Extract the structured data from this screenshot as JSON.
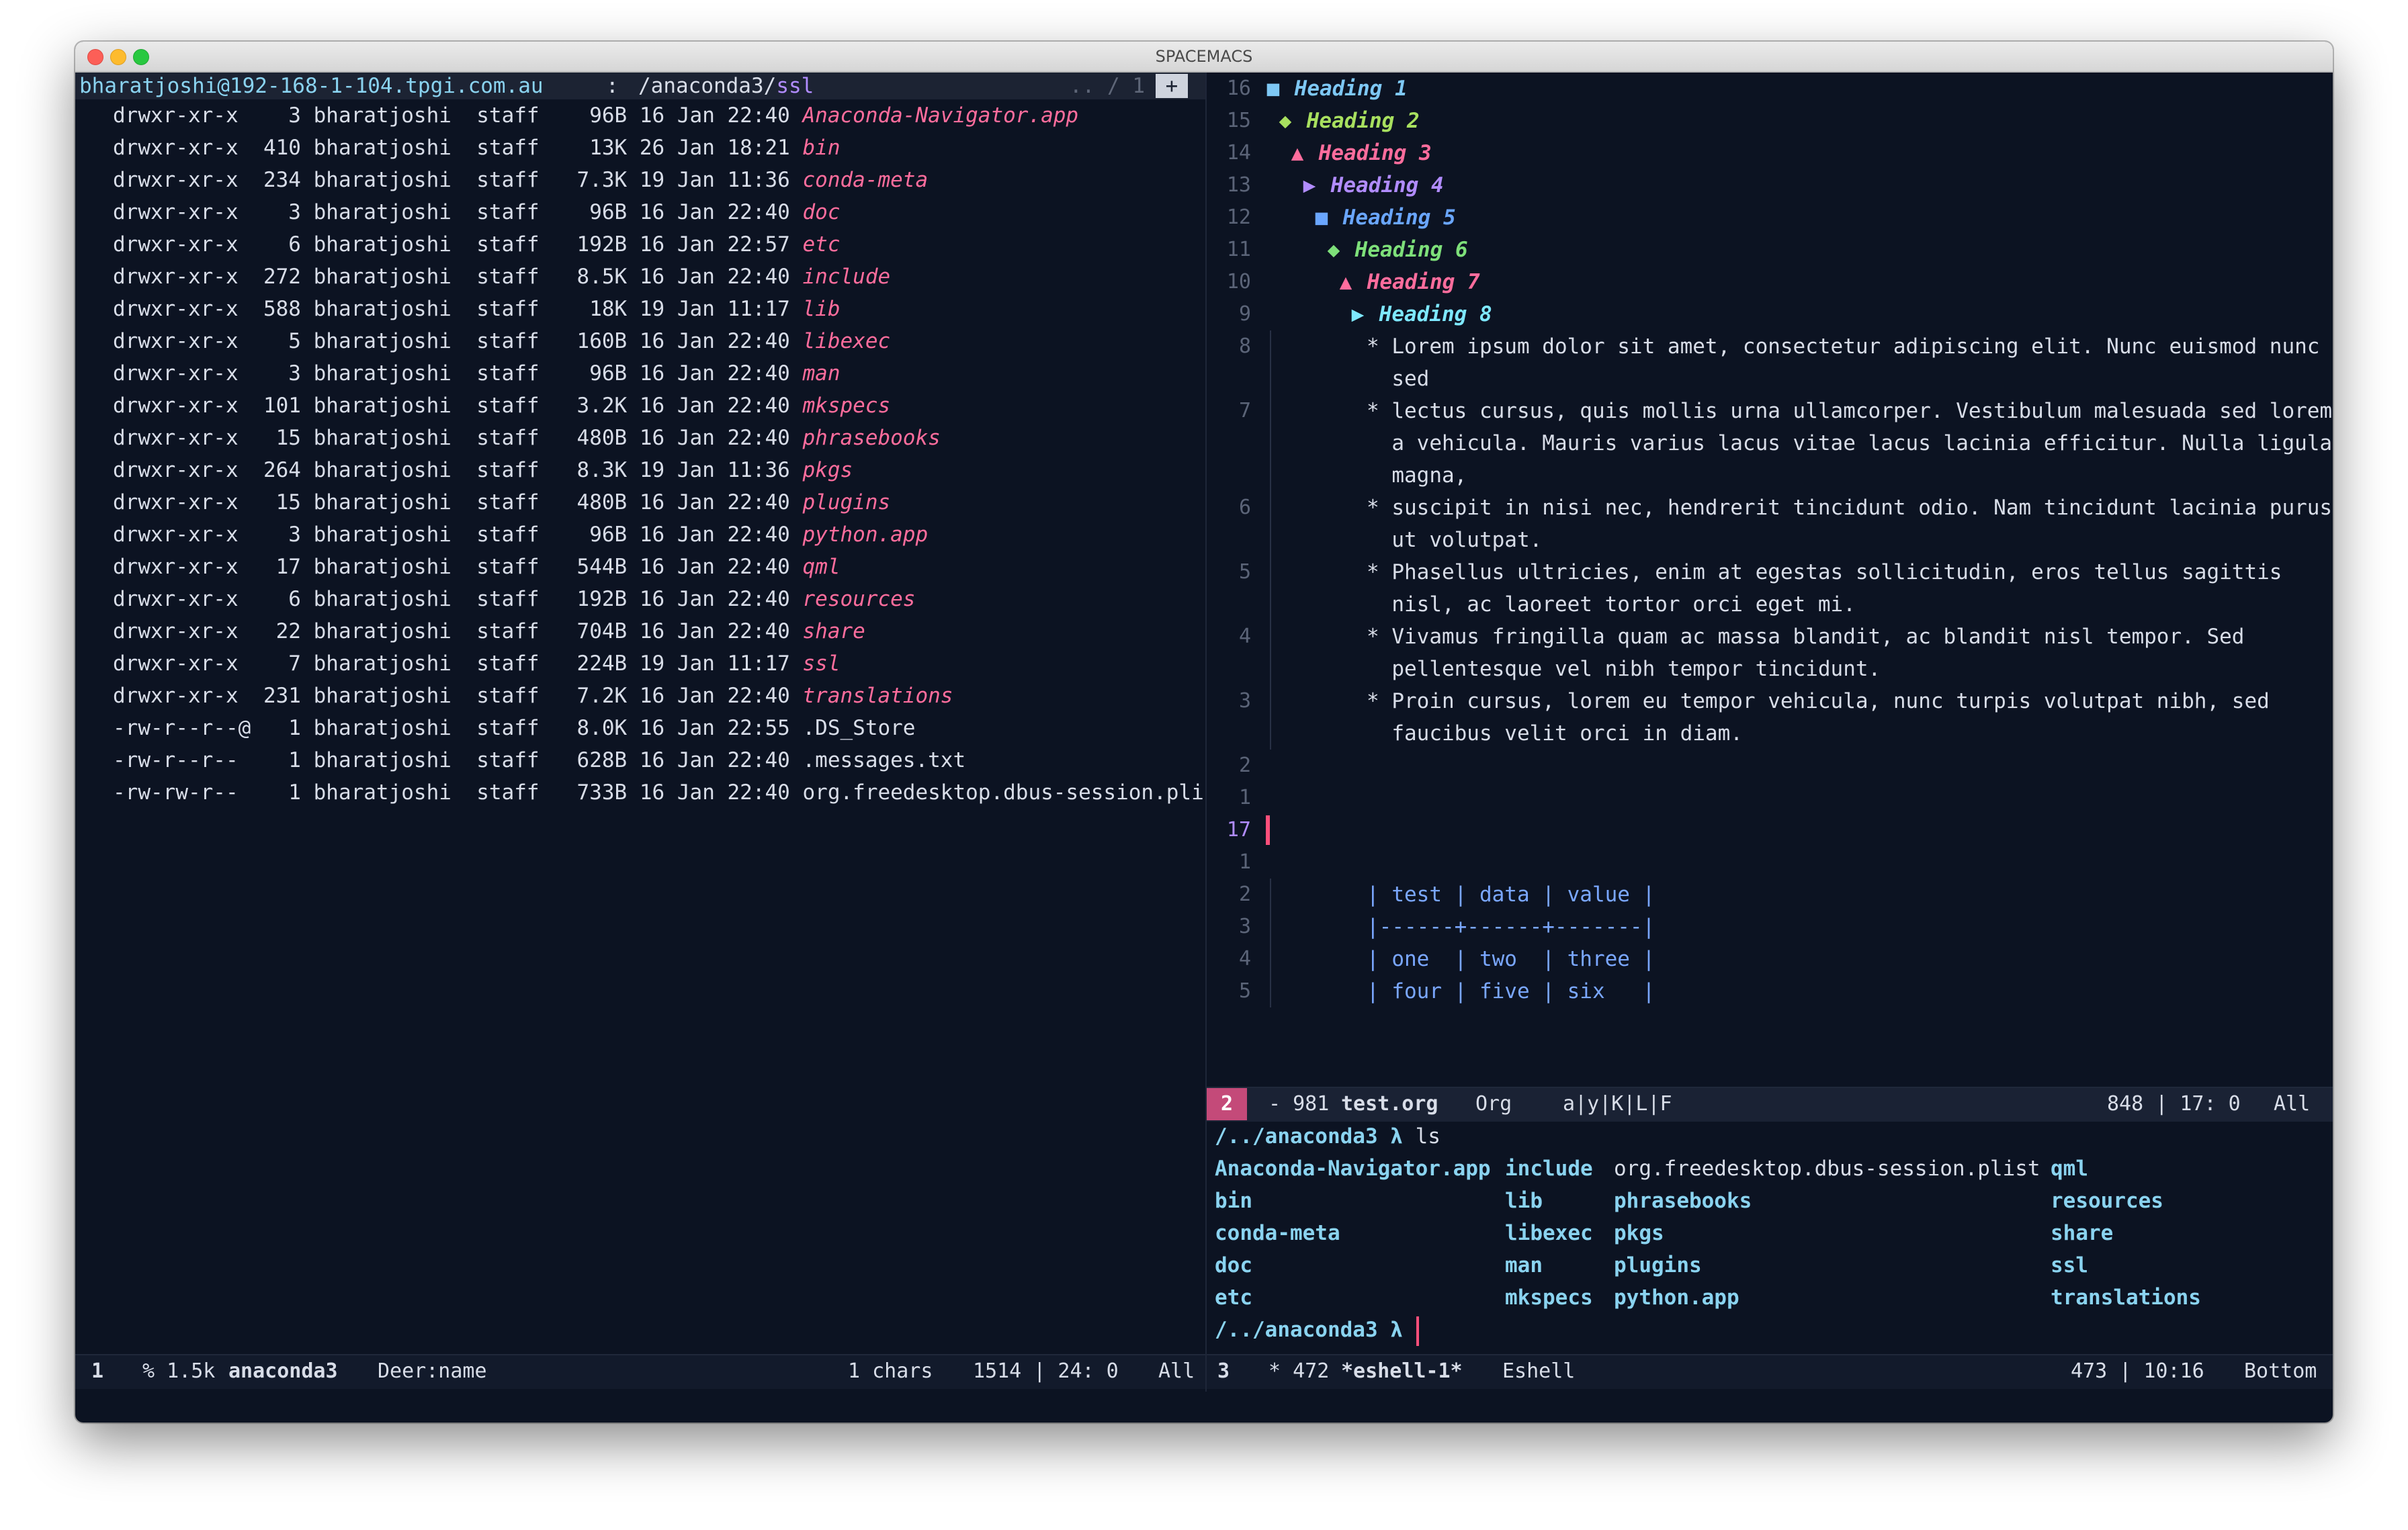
{
  "window": {
    "title": "SPACEMACS"
  },
  "left_pane": {
    "header": {
      "host": "bharatjoshi@192-168-1-104.tpgi.com.au",
      "sep": ":",
      "path": "/anaconda3/",
      "path_tail": "ssl",
      "position": ".. / 1",
      "plus": "+"
    },
    "listing": [
      {
        "perm": "drwxr-xr-x",
        "links": "3",
        "owner": "bharatjoshi",
        "group": "staff",
        "size": "96B",
        "date": "16 Jan 22:40",
        "name": "Anaconda-Navigator.app",
        "dir": true
      },
      {
        "perm": "drwxr-xr-x",
        "links": "410",
        "owner": "bharatjoshi",
        "group": "staff",
        "size": "13K",
        "date": "26 Jan 18:21",
        "name": "bin",
        "dir": true
      },
      {
        "perm": "drwxr-xr-x",
        "links": "234",
        "owner": "bharatjoshi",
        "group": "staff",
        "size": "7.3K",
        "date": "19 Jan 11:36",
        "name": "conda-meta",
        "dir": true
      },
      {
        "perm": "drwxr-xr-x",
        "links": "3",
        "owner": "bharatjoshi",
        "group": "staff",
        "size": "96B",
        "date": "16 Jan 22:40",
        "name": "doc",
        "dir": true
      },
      {
        "perm": "drwxr-xr-x",
        "links": "6",
        "owner": "bharatjoshi",
        "group": "staff",
        "size": "192B",
        "date": "16 Jan 22:57",
        "name": "etc",
        "dir": true
      },
      {
        "perm": "drwxr-xr-x",
        "links": "272",
        "owner": "bharatjoshi",
        "group": "staff",
        "size": "8.5K",
        "date": "16 Jan 22:40",
        "name": "include",
        "dir": true
      },
      {
        "perm": "drwxr-xr-x",
        "links": "588",
        "owner": "bharatjoshi",
        "group": "staff",
        "size": "18K",
        "date": "19 Jan 11:17",
        "name": "lib",
        "dir": true
      },
      {
        "perm": "drwxr-xr-x",
        "links": "5",
        "owner": "bharatjoshi",
        "group": "staff",
        "size": "160B",
        "date": "16 Jan 22:40",
        "name": "libexec",
        "dir": true
      },
      {
        "perm": "drwxr-xr-x",
        "links": "3",
        "owner": "bharatjoshi",
        "group": "staff",
        "size": "96B",
        "date": "16 Jan 22:40",
        "name": "man",
        "dir": true
      },
      {
        "perm": "drwxr-xr-x",
        "links": "101",
        "owner": "bharatjoshi",
        "group": "staff",
        "size": "3.2K",
        "date": "16 Jan 22:40",
        "name": "mkspecs",
        "dir": true
      },
      {
        "perm": "drwxr-xr-x",
        "links": "15",
        "owner": "bharatjoshi",
        "group": "staff",
        "size": "480B",
        "date": "16 Jan 22:40",
        "name": "phrasebooks",
        "dir": true
      },
      {
        "perm": "drwxr-xr-x",
        "links": "264",
        "owner": "bharatjoshi",
        "group": "staff",
        "size": "8.3K",
        "date": "19 Jan 11:36",
        "name": "pkgs",
        "dir": true
      },
      {
        "perm": "drwxr-xr-x",
        "links": "15",
        "owner": "bharatjoshi",
        "group": "staff",
        "size": "480B",
        "date": "16 Jan 22:40",
        "name": "plugins",
        "dir": true
      },
      {
        "perm": "drwxr-xr-x",
        "links": "3",
        "owner": "bharatjoshi",
        "group": "staff",
        "size": "96B",
        "date": "16 Jan 22:40",
        "name": "python.app",
        "dir": true
      },
      {
        "perm": "drwxr-xr-x",
        "links": "17",
        "owner": "bharatjoshi",
        "group": "staff",
        "size": "544B",
        "date": "16 Jan 22:40",
        "name": "qml",
        "dir": true
      },
      {
        "perm": "drwxr-xr-x",
        "links": "6",
        "owner": "bharatjoshi",
        "group": "staff",
        "size": "192B",
        "date": "16 Jan 22:40",
        "name": "resources",
        "dir": true
      },
      {
        "perm": "drwxr-xr-x",
        "links": "22",
        "owner": "bharatjoshi",
        "group": "staff",
        "size": "704B",
        "date": "16 Jan 22:40",
        "name": "share",
        "dir": true
      },
      {
        "perm": "drwxr-xr-x",
        "links": "7",
        "owner": "bharatjoshi",
        "group": "staff",
        "size": "224B",
        "date": "19 Jan 11:17",
        "name": "ssl",
        "dir": true
      },
      {
        "perm": "drwxr-xr-x",
        "links": "231",
        "owner": "bharatjoshi",
        "group": "staff",
        "size": "7.2K",
        "date": "16 Jan 22:40",
        "name": "translations",
        "dir": true
      },
      {
        "perm": "-rw-r--r--@",
        "links": "1",
        "owner": "bharatjoshi",
        "group": "staff",
        "size": "8.0K",
        "date": "16 Jan 22:55",
        "name": ".DS_Store",
        "dir": false
      },
      {
        "perm": "-rw-r--r--",
        "links": "1",
        "owner": "bharatjoshi",
        "group": "staff",
        "size": "628B",
        "date": "16 Jan 22:40",
        "name": ".messages.txt",
        "dir": false
      },
      {
        "perm": "-rw-rw-r--",
        "links": "1",
        "owner": "bharatjoshi",
        "group": "staff",
        "size": "733B",
        "date": "16 Jan 22:40",
        "name": "org.freedesktop.dbus-session.plist",
        "dir": false
      }
    ],
    "modeline": {
      "window_num": "1",
      "state": "% 1.5k",
      "buffer": "anaconda3",
      "mode": "Deer:name",
      "chars": "1 chars",
      "position": "1514 | 24: 0",
      "scroll": "All"
    }
  },
  "org_pane": {
    "headings": [
      {
        "lnum": "16",
        "marker": "■",
        "text": "Heading 1",
        "color": "#7ec8f5"
      },
      {
        "lnum": "15",
        "marker": "◆",
        "text": "Heading 2",
        "color": "#a8e05f"
      },
      {
        "lnum": "14",
        "marker": "▲",
        "text": "Heading 3",
        "color": "#ff6d9d"
      },
      {
        "lnum": "13",
        "marker": "▶",
        "text": "Heading 4",
        "color": "#b18cff"
      },
      {
        "lnum": "12",
        "marker": "■",
        "text": "Heading 5",
        "color": "#6aa6ff"
      },
      {
        "lnum": "11",
        "marker": "◆",
        "text": "Heading 6",
        "color": "#7ee07a"
      },
      {
        "lnum": "10",
        "marker": "▲",
        "text": "Heading 7",
        "color": "#ff6d9d"
      },
      {
        "lnum": "9",
        "marker": "▶",
        "text": "Heading 8",
        "color": "#7ee8ff"
      }
    ],
    "bullets": [
      {
        "lnum": "8",
        "lines": [
          "* Lorem ipsum dolor sit amet, consectetur adipiscing elit. Nunc euismod nunc",
          "  sed"
        ]
      },
      {
        "lnum": "7",
        "lines": [
          "* lectus cursus, quis mollis urna ullamcorper. Vestibulum malesuada sed lorem",
          "  a vehicula. Mauris varius lacus vitae lacus lacinia efficitur. Nulla ligula",
          "  magna,"
        ]
      },
      {
        "lnum": "6",
        "lines": [
          "* suscipit in nisi nec, hendrerit tincidunt odio. Nam tincidunt lacinia purus",
          "  ut volutpat."
        ]
      },
      {
        "lnum": "5",
        "lines": [
          "* Phasellus ultricies, enim at egestas sollicitudin, eros tellus sagittis",
          "  nisl, ac laoreet tortor orci eget mi."
        ]
      },
      {
        "lnum": "4",
        "lines": [
          "* Vivamus fringilla quam ac massa blandit, ac blandit nisl tempor. Sed",
          "  pellentesque vel nibh tempor tincidunt."
        ]
      },
      {
        "lnum": "3",
        "lines": [
          "* Proin cursus, lorem eu tempor vehicula, nunc turpis volutpat nibh, sed",
          "  faucibus velit orci in diam."
        ]
      }
    ],
    "blank_lnums": [
      "2",
      "1"
    ],
    "current_lnum": "17",
    "after_lnums": [
      "1"
    ],
    "table": [
      {
        "lnum": "2",
        "text": "| test | data | value |"
      },
      {
        "lnum": "3",
        "text": "|------+------+-------|"
      },
      {
        "lnum": "4",
        "text": "| one  | two  | three |"
      },
      {
        "lnum": "5",
        "text": "| four | five | six   |"
      }
    ],
    "modeline": {
      "window_num": "2",
      "state": "- 981",
      "buffer": "test.org",
      "mode": "Org",
      "flags": "a|y|K|L|F",
      "position": "848 | 17: 0",
      "scroll": "All"
    }
  },
  "eshell_pane": {
    "prompt1": "/../anaconda3 λ",
    "command": "ls",
    "columns": [
      [
        "Anaconda-Navigator.app",
        "bin",
        "conda-meta",
        "doc",
        "etc"
      ],
      [
        "include",
        "lib",
        "libexec",
        "man",
        "mkspecs"
      ],
      [
        "org.freedesktop.dbus-session.plist",
        "phrasebooks",
        "pkgs",
        "plugins",
        "python.app"
      ],
      [
        "qml",
        "resources",
        "share",
        "ssl",
        "translations"
      ]
    ],
    "prompt2": "/../anaconda3 λ",
    "modeline": {
      "window_num": "3",
      "state": "* 472",
      "buffer": "*eshell-1*",
      "mode": "Eshell",
      "position": "473 | 10:16",
      "scroll": "Bottom"
    }
  },
  "colors": {
    "background": "#0c1322",
    "dir_name": "#ff6d9d",
    "eshell_dir": "#8ad3f0",
    "modeline_badge": "#c44a79"
  }
}
